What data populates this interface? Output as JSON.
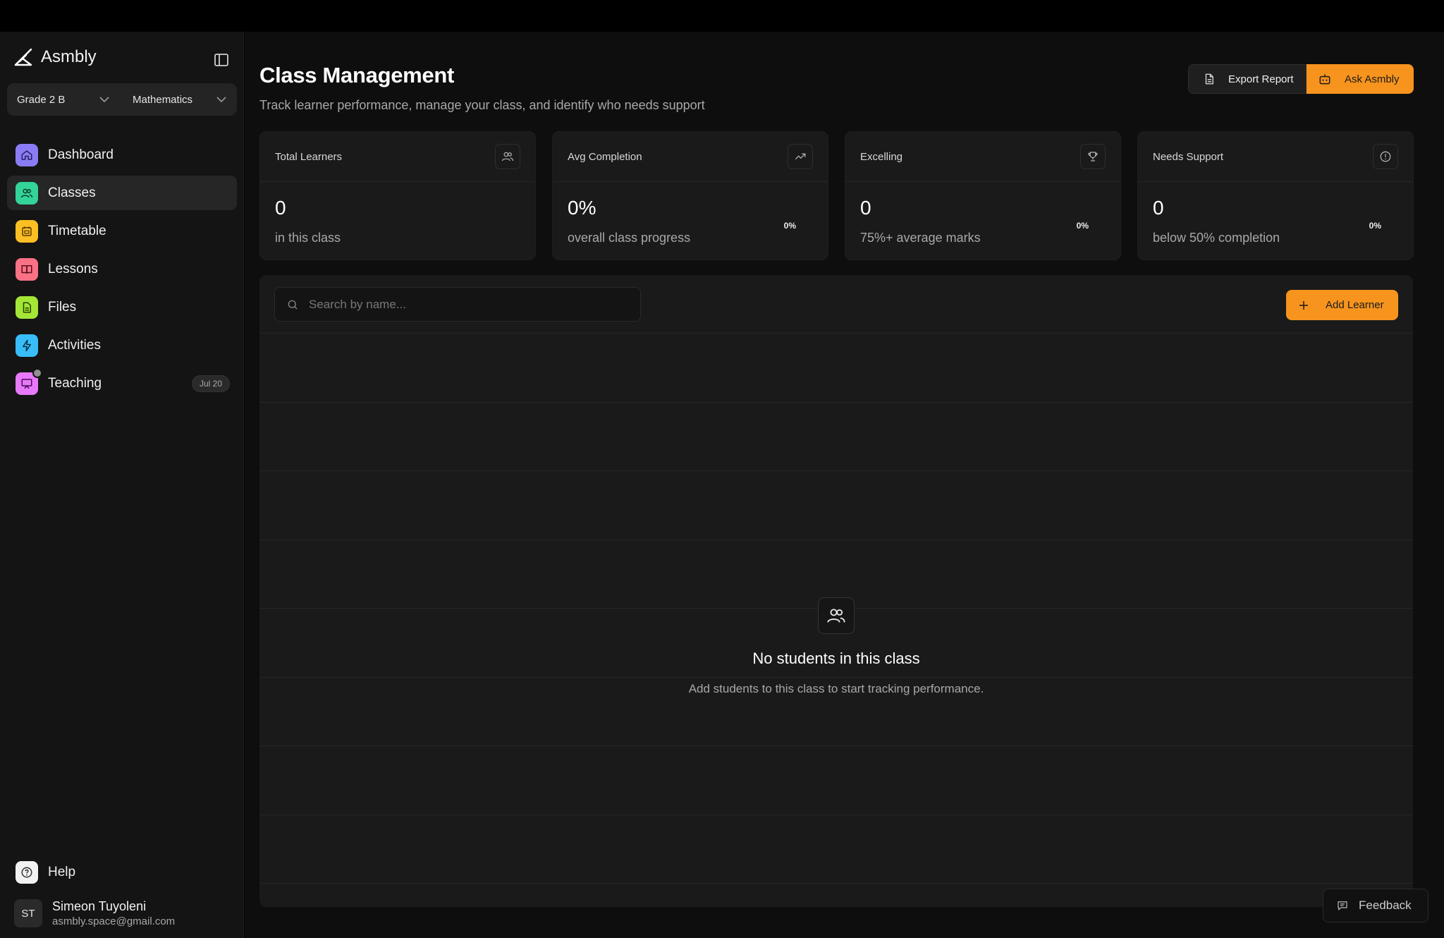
{
  "app": {
    "name": "Asmbly"
  },
  "selectors": {
    "grade": "Grade 2 B",
    "subject": "Mathematics"
  },
  "nav": {
    "items": [
      {
        "label": "Dashboard",
        "icon": "home-icon",
        "color": "#a78bfa"
      },
      {
        "label": "Classes",
        "icon": "users-icon",
        "color": "#4ade80"
      },
      {
        "label": "Timetable",
        "icon": "calendar-icon",
        "color": "#fbbf24"
      },
      {
        "label": "Lessons",
        "icon": "book-icon",
        "color": "#fb7185"
      },
      {
        "label": "Files",
        "icon": "file-icon",
        "color": "#a3e635"
      },
      {
        "label": "Activities",
        "icon": "bolt-icon",
        "color": "#38bdf8"
      },
      {
        "label": "Teaching",
        "icon": "presentation-icon",
        "color": "#e879f9",
        "badge": "Jul 20"
      }
    ],
    "active": "Classes"
  },
  "help": {
    "label": "Help"
  },
  "user": {
    "initials": "ST",
    "name": "Simeon Tuyoleni",
    "email": "asmbly.space@gmail.com"
  },
  "header": {
    "title": "Class Management",
    "subtitle": "Track learner performance, manage your class, and identify who needs support",
    "export_label": "Export Report",
    "ask_label": "Ask Asmbly"
  },
  "stats": [
    {
      "title": "Total Learners",
      "value": "0",
      "desc": "in this class",
      "icon": "users-icon"
    },
    {
      "title": "Avg Completion",
      "value": "0%",
      "desc": "overall class progress",
      "pct": "0%",
      "icon": "trending-up-icon"
    },
    {
      "title": "Excelling",
      "value": "0",
      "desc": "75%+ average marks",
      "pct": "0%",
      "icon": "trophy-icon"
    },
    {
      "title": "Needs Support",
      "value": "0",
      "desc": "below 50% completion",
      "pct": "0%",
      "icon": "alert-circle-icon"
    }
  ],
  "table": {
    "search_placeholder": "Search by name...",
    "add_label": "Add Learner",
    "empty_title": "No students in this class",
    "empty_sub": "Add students to this class to start tracking performance."
  },
  "feedback": {
    "label": "Feedback"
  },
  "colors": {
    "accent": "#f7941d",
    "background": "#0e0e0e",
    "panel": "#1a1a1a"
  }
}
